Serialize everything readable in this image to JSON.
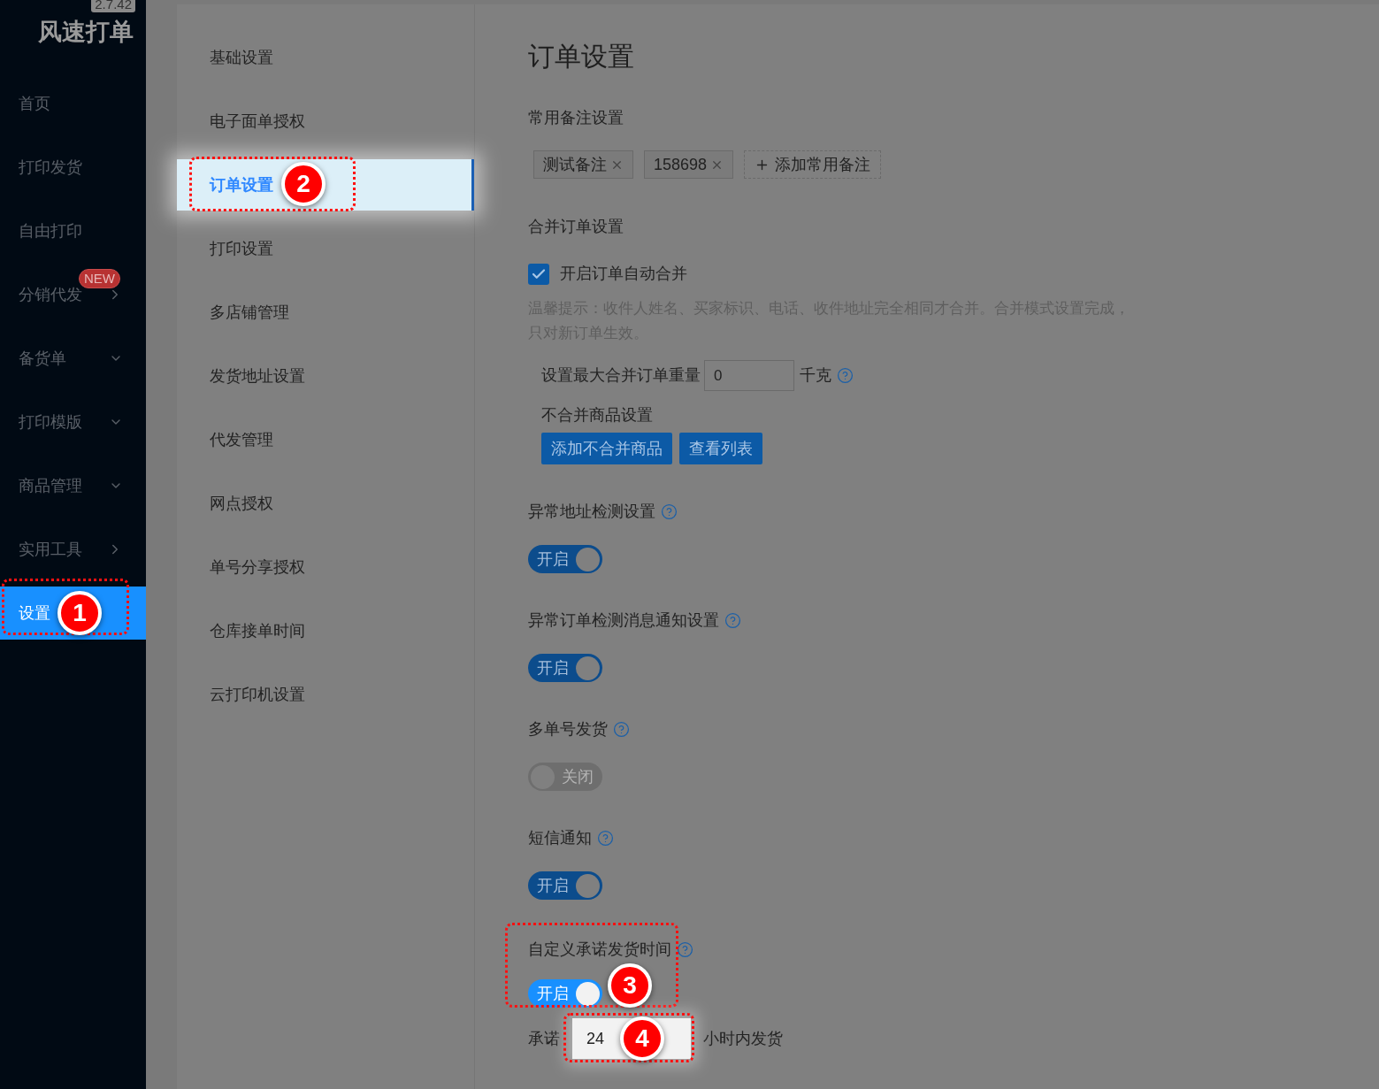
{
  "app": {
    "version": "2.7.42",
    "title": "风速打单"
  },
  "sidebar": {
    "items": [
      {
        "label": "首页",
        "kind": "plain",
        "selected": false
      },
      {
        "label": "打印发货",
        "kind": "plain",
        "selected": false
      },
      {
        "label": "自由打印",
        "kind": "plain",
        "selected": false
      },
      {
        "label": "分销代发",
        "kind": "arrow",
        "badge": "NEW",
        "selected": false
      },
      {
        "label": "备货单",
        "kind": "dropdown",
        "selected": false
      },
      {
        "label": "打印模版",
        "kind": "dropdown",
        "selected": false
      },
      {
        "label": "商品管理",
        "kind": "dropdown",
        "selected": false
      },
      {
        "label": "实用工具",
        "kind": "arrow",
        "selected": false
      },
      {
        "label": "设置",
        "kind": "plain",
        "selected": true,
        "callout": "1"
      }
    ]
  },
  "settings_menu": {
    "items": [
      {
        "label": "基础设置",
        "selected": false
      },
      {
        "label": "电子面单授权",
        "selected": false
      },
      {
        "label": "订单设置",
        "selected": true,
        "callout": "2"
      },
      {
        "label": "打印设置",
        "selected": false
      },
      {
        "label": "多店铺管理",
        "selected": false
      },
      {
        "label": "发货地址设置",
        "selected": false
      },
      {
        "label": "代发管理",
        "selected": false
      },
      {
        "label": "网点授权",
        "selected": false
      },
      {
        "label": "单号分享授权",
        "selected": false
      },
      {
        "label": "仓库接单时间",
        "selected": false
      },
      {
        "label": "云打印机设置",
        "selected": false
      }
    ]
  },
  "page": {
    "title": "订单设置",
    "sections": [
      {
        "kind": "notes",
        "heading": "常用备注设置",
        "tags": [
          "测试备注",
          "158698"
        ],
        "add_button": "添加常用备注"
      },
      {
        "kind": "merge",
        "heading": "合并订单设置",
        "checkbox": {
          "label": "开启订单自动合并",
          "checked": true
        },
        "hint": "温馨提示：收件人姓名、买家标识、电话、收件地址完全相同才合并。合并模式设置完成，只对新订单生效。",
        "weight": {
          "label": "设置最大合并订单重量",
          "value": "0",
          "unit": "千克"
        },
        "exclude": {
          "label": "不合并商品设置",
          "buttons": [
            "添加不合并商品",
            "查看列表"
          ]
        }
      },
      {
        "kind": "toggle",
        "heading": "异常地址检测设置",
        "switch": {
          "on": true,
          "label": "开启"
        }
      },
      {
        "kind": "toggle",
        "heading": "异常订单检测消息通知设置",
        "switch": {
          "on": true,
          "label": "开启"
        }
      },
      {
        "kind": "toggle",
        "heading": "多单号发货",
        "switch": {
          "on": false,
          "label": "关闭"
        }
      },
      {
        "kind": "toggle",
        "heading": "短信通知",
        "switch": {
          "on": true,
          "label": "开启"
        }
      },
      {
        "kind": "toggle",
        "heading": "自定义承诺发货时间",
        "switch": {
          "on": true,
          "label": "开启"
        },
        "callout": "3"
      },
      {
        "kind": "promise",
        "prefix": "承诺",
        "value": "24",
        "suffix": "小时内发货",
        "callout": "4"
      }
    ]
  }
}
